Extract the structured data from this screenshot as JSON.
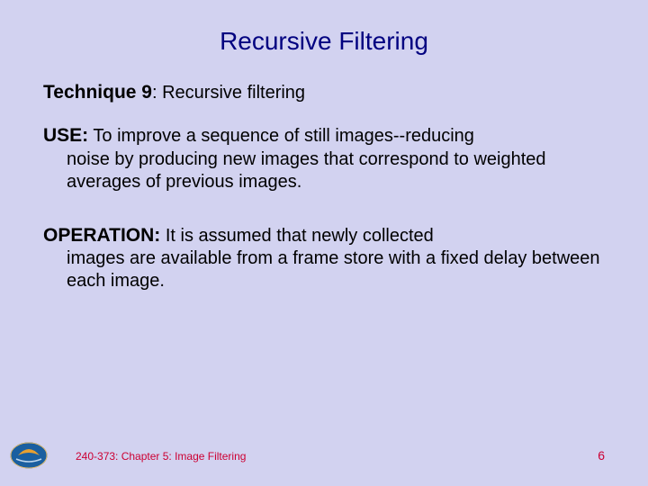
{
  "slide": {
    "title": "Recursive Filtering",
    "technique_label": "Technique 9",
    "technique_sep": ":  ",
    "technique_text": "Recursive filtering",
    "use_label": "USE:",
    "use_first": "  To improve a sequence of still images--reducing",
    "use_rest": "noise by producing new images that correspond to weighted averages of previous images.",
    "operation_label": "OPERATION:",
    "operation_first": "  It is assumed that newly collected",
    "operation_rest": "images are available from a frame store with a fixed delay between each image."
  },
  "footer": {
    "chapter": "240-373: Chapter 5: Image Filtering",
    "page": "6"
  },
  "colors": {
    "background": "#d2d2f0",
    "title": "#000080",
    "footer": "#cc0033"
  }
}
